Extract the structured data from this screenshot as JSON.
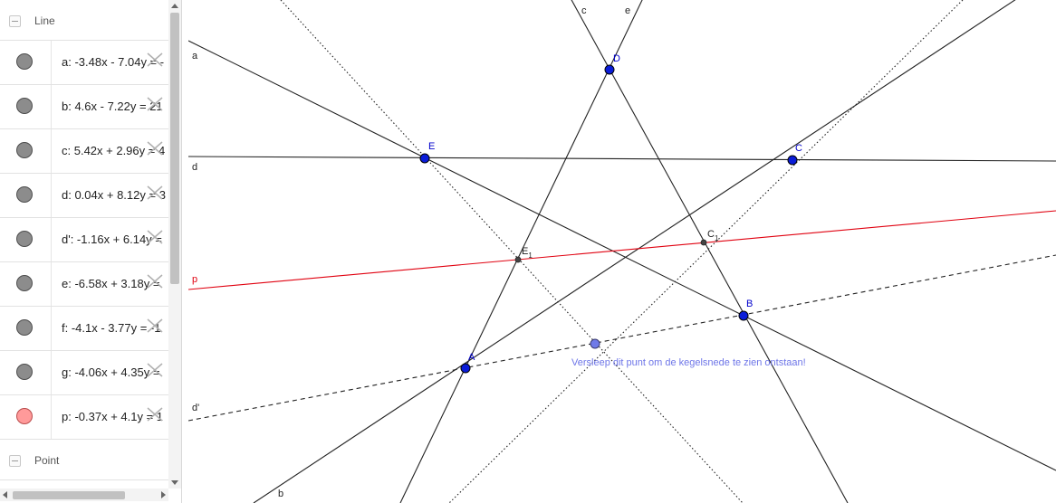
{
  "algebra": {
    "group_line": "Line",
    "group_point": "Point",
    "rows": [
      {
        "eq": "a: -3.48x - 7.04y = -",
        "color": "#8c8c8c"
      },
      {
        "eq": "b: 4.6x - 7.22y = 21",
        "color": "#8c8c8c"
      },
      {
        "eq": "c: 5.42x + 2.96y = 4",
        "color": "#8c8c8c"
      },
      {
        "eq": "d: 0.04x + 8.12y = 3",
        "color": "#8c8c8c"
      },
      {
        "eq": "d': -1.16x + 6.14y = ",
        "color": "#8c8c8c"
      },
      {
        "eq": "e: -6.58x + 3.18y = ",
        "color": "#8c8c8c"
      },
      {
        "eq": "f: -4.1x - 3.77y = -1",
        "color": "#8c8c8c"
      },
      {
        "eq": "g: -4.06x + 4.35y = ",
        "color": "#8c8c8c"
      },
      {
        "eq": "p: -0.37x + 4.1y = 1",
        "color": "#ff9a9a"
      }
    ]
  },
  "graphics": {
    "line_labels": {
      "a": "a",
      "b": "b",
      "c": "c",
      "d": "d",
      "e": "e",
      "p": "p",
      "d_prime": "d'"
    },
    "point_labels": {
      "A": "A",
      "B": "B",
      "C": "C",
      "D": "D",
      "E": "E",
      "E1": "E",
      "E1_sub": "1",
      "C1": "C",
      "C1_sub": "1"
    },
    "hint": "Versleep dit punt om de kegelsnede te zien ontstaan!",
    "colors": {
      "line": "#222222",
      "red_line": "#e0000f",
      "point_fill": "#0a1cd8",
      "hint": "#6e76e8",
      "drag_point": "#6f7ae8"
    }
  }
}
